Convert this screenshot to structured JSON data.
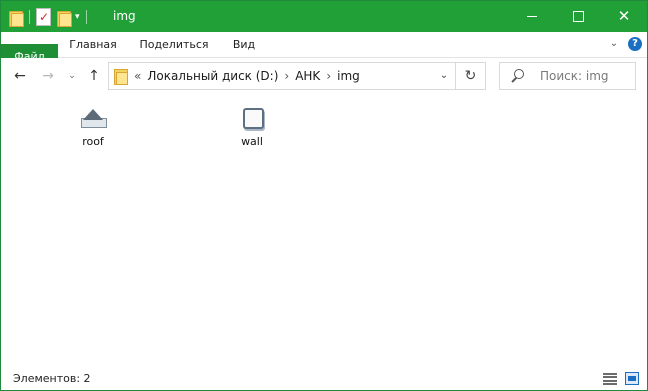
{
  "window": {
    "title": "img",
    "accent_color": "#21a038",
    "controls": {
      "minimize_icon": "minimize-icon",
      "maximize_icon": "maximize-icon",
      "close_icon": "close-icon"
    }
  },
  "quick_access_toolbar": {
    "icons": [
      "folder-icon",
      "properties-icon",
      "new-folder-icon",
      "customize-dropdown-icon"
    ]
  },
  "ribbon": {
    "tabs": [
      {
        "label": "Файл",
        "active": true
      },
      {
        "label": "Главная"
      },
      {
        "label": "Поделиться"
      },
      {
        "label": "Вид"
      }
    ]
  },
  "navigation": {
    "overflow": "«",
    "breadcrumbs": [
      "Локальный диск (D:)",
      "AHK",
      "img"
    ],
    "separator": "›",
    "refresh_glyph": "↻",
    "search": {
      "placeholder": "Поиск: img"
    }
  },
  "files": [
    {
      "name": "roof",
      "icon": "roof-image-icon"
    },
    {
      "name": "wall",
      "icon": "wall-image-icon"
    }
  ],
  "status": {
    "item_count": "Элементов: 2",
    "views": [
      "details-view-icon",
      "large-icons-view-icon"
    ],
    "selected_view": "large-icons-view-icon"
  }
}
